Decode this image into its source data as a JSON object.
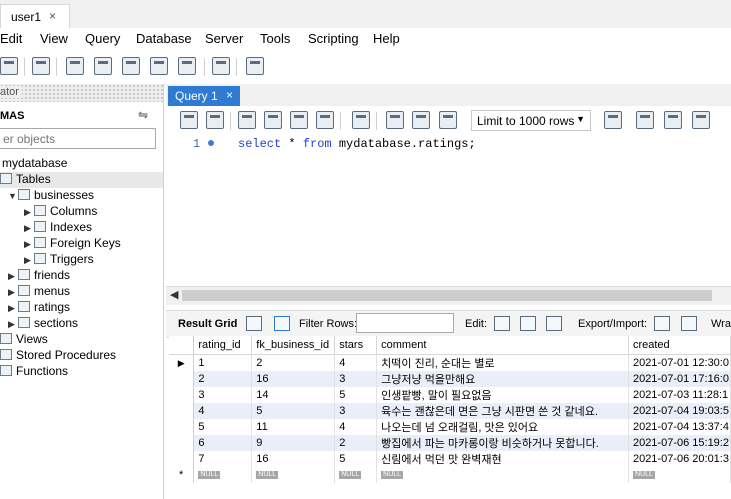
{
  "document_tab": {
    "label": "user1",
    "close": "×"
  },
  "menu": [
    "Edit",
    "View",
    "Query",
    "Database",
    "Server",
    "Tools",
    "Scripting",
    "Help"
  ],
  "navigator": {
    "header": "ator",
    "schemas_title": "MAS",
    "filter_placeholder": "er objects",
    "tree": [
      {
        "label": "mydatabase",
        "icon": "database-icon",
        "level": 0,
        "arrow": ""
      },
      {
        "label": "Tables",
        "icon": "folder-icon",
        "level": 0,
        "arrow": ""
      },
      {
        "label": "businesses",
        "icon": "table-icon",
        "level": 1,
        "arrow": "▼"
      },
      {
        "label": "Columns",
        "icon": "columns-icon",
        "level": 2,
        "arrow": "▶"
      },
      {
        "label": "Indexes",
        "icon": "indexes-icon",
        "level": 2,
        "arrow": "▶"
      },
      {
        "label": "Foreign Keys",
        "icon": "foreign-keys-icon",
        "level": 2,
        "arrow": "▶"
      },
      {
        "label": "Triggers",
        "icon": "triggers-icon",
        "level": 2,
        "arrow": "▶"
      },
      {
        "label": "friends",
        "icon": "table-icon",
        "level": 1,
        "arrow": "▶"
      },
      {
        "label": "menus",
        "icon": "table-icon",
        "level": 1,
        "arrow": "▶"
      },
      {
        "label": "ratings",
        "icon": "table-icon",
        "level": 1,
        "arrow": "▶"
      },
      {
        "label": "sections",
        "icon": "table-icon",
        "level": 1,
        "arrow": "▶"
      },
      {
        "label": "Views",
        "icon": "folder-icon",
        "level": 0,
        "arrow": ""
      },
      {
        "label": "Stored Procedures",
        "icon": "folder-icon",
        "level": 0,
        "arrow": ""
      },
      {
        "label": "Functions",
        "icon": "folder-icon",
        "level": 0,
        "arrow": ""
      }
    ]
  },
  "query_tab": {
    "label": "Query 1",
    "close": "×"
  },
  "query_toolbar": {
    "limit_value": "Limit to 1000 rows"
  },
  "editor": {
    "line_number": "1",
    "keyword_select": "select",
    "star": "*",
    "keyword_from": "from",
    "table_name": "mydatabase.ratings;"
  },
  "result_bar": {
    "result_grid": "Result Grid",
    "filter_rows": "Filter Rows:",
    "edit": "Edit:",
    "export_import": "Export/Import:",
    "wrap": "Wra"
  },
  "grid": {
    "columns": [
      "rating_id",
      "fk_business_id",
      "stars",
      "comment",
      "created"
    ],
    "rows": [
      [
        "1",
        "2",
        "4",
        "치떡이 진리, 순대는 별로",
        "2021-07-01 12:30:0"
      ],
      [
        "2",
        "16",
        "3",
        "그냥저냥 먹을만해요",
        "2021-07-01 17:16:0"
      ],
      [
        "3",
        "14",
        "5",
        "인생팥빵, 말이 필요없음",
        "2021-07-03 11:28:1"
      ],
      [
        "4",
        "5",
        "3",
        "육수는 괜찮은데 면은 그냥 시판면 쓴 것 같네요.",
        "2021-07-04 19:03:5"
      ],
      [
        "5",
        "11",
        "4",
        "나오는데 넘 오래걸림, 맛은 있어요",
        "2021-07-04 13:37:4"
      ],
      [
        "6",
        "9",
        "2",
        "빵집에서 파는 마카롱이랑 비슷하거나 못합니다.",
        "2021-07-06 15:19:2"
      ],
      [
        "7",
        "16",
        "5",
        "신림에서 먹던 맛 완벽재현",
        "2021-07-06 20:01:3"
      ]
    ],
    "null_label": "NULL",
    "current_row_marker": "▶",
    "new_row_marker": "*"
  }
}
